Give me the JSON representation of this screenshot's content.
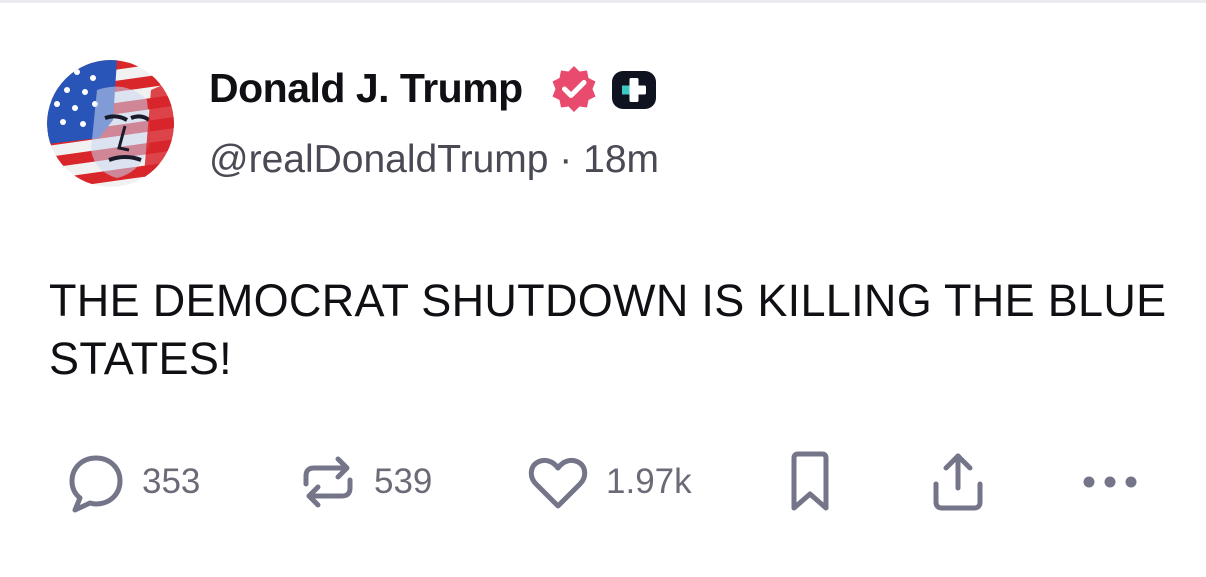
{
  "post": {
    "author": {
      "display_name": "Donald J. Trump",
      "handle": "@realDonaldTrump",
      "separator": "·",
      "time_ago": "18m",
      "verified_color": "#e84b6d",
      "avatar_icon": "flag-portrait-avatar"
    },
    "body": "THE DEMOCRAT SHUTDOWN IS KILLING THE BLUE STATES!",
    "actions": {
      "replies": "353",
      "reposts": "539",
      "likes": "1.97k"
    }
  },
  "colors": {
    "text": "#0f0f14",
    "muted": "#4a4a55",
    "action_icon": "#75758a",
    "accent": "#e84b6d"
  }
}
